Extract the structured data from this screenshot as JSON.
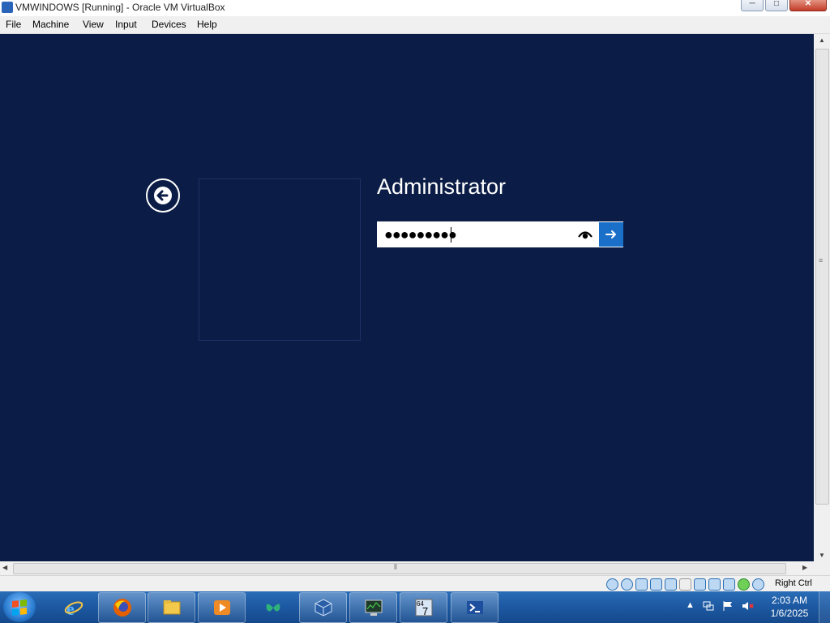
{
  "window": {
    "title": "VMWINDOWS [Running] - Oracle VM VirtualBox",
    "minimize_glyph": "─",
    "maximize_glyph": "□",
    "close_glyph": "✕"
  },
  "menu": {
    "file": "File",
    "machine": "Machine",
    "view": "View",
    "input": "Input",
    "devices": "Devices",
    "help": "Help"
  },
  "login": {
    "username": "Administrator",
    "password_mask": "●●●●●●●●●",
    "password_length": 9
  },
  "statusbar": {
    "host_key": "Right Ctrl",
    "icons": [
      "hard-disk-icon",
      "optical-drive-icon",
      "audio-icon",
      "network-icon",
      "usb-icon",
      "shared-folders-icon",
      "display-icon",
      "recording-icon",
      "virtualization-icon",
      "mouse-integration-icon",
      "keyboard-icon"
    ]
  },
  "taskbar": {
    "apps": [
      "internet-explorer",
      "firefox",
      "file-explorer",
      "media-player",
      "msn",
      "virtualbox",
      "task-manager",
      "windows-7-64-bit",
      "powershell"
    ],
    "clock_time": "2:03 AM",
    "clock_date": "1/6/2025",
    "tray_expand_glyph": "▲"
  },
  "colors": {
    "vm_background": "#0b1c46",
    "submit_button": "#1a6fc9",
    "taskbar": "#1d5aa3"
  }
}
